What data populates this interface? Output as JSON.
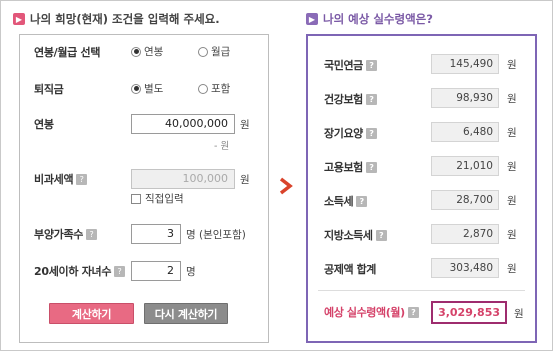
{
  "left_section": {
    "title": "나의 희망(현재) 조건을 입력해 주세요.",
    "salary_type": {
      "label": "연봉/월급 선택",
      "options": [
        "연봉",
        "월급"
      ],
      "selected": "연봉"
    },
    "severance": {
      "label": "퇴직금",
      "options": [
        "별도",
        "포함"
      ],
      "selected": "별도"
    },
    "annual_salary": {
      "label": "연봉",
      "value": "40,000,000",
      "unit": "원",
      "note": "- 원"
    },
    "non_taxable": {
      "label": "비과세액",
      "value": "100,000",
      "unit": "원",
      "checkbox_label": "직접입력"
    },
    "dependents": {
      "label": "부양가족수",
      "value": "3",
      "unit": "명 (본인포함)"
    },
    "children": {
      "label": "20세이하 자녀수",
      "value": "2",
      "unit": "명"
    },
    "calc_button": "계산하기",
    "reset_button": "다시 계산하기"
  },
  "right_section": {
    "title": "나의 예상 실수령액은?",
    "unit": "원",
    "items": [
      {
        "label": "국민연금",
        "value": "145,490"
      },
      {
        "label": "건강보험",
        "value": "98,930"
      },
      {
        "label": "장기요양",
        "value": "6,480"
      },
      {
        "label": "고용보험",
        "value": "21,010"
      },
      {
        "label": "소득세",
        "value": "28,700"
      },
      {
        "label": "지방소득세",
        "value": "2,870"
      },
      {
        "label": "공제액 합계",
        "value": "303,480"
      }
    ],
    "total": {
      "label": "예상 실수령액(월)",
      "value": "3,029,853"
    }
  },
  "help_glyph": "?",
  "colors": {
    "accent_pink": "#e86a83",
    "accent_purple": "#7e65b5",
    "total_red": "#d5436a"
  }
}
